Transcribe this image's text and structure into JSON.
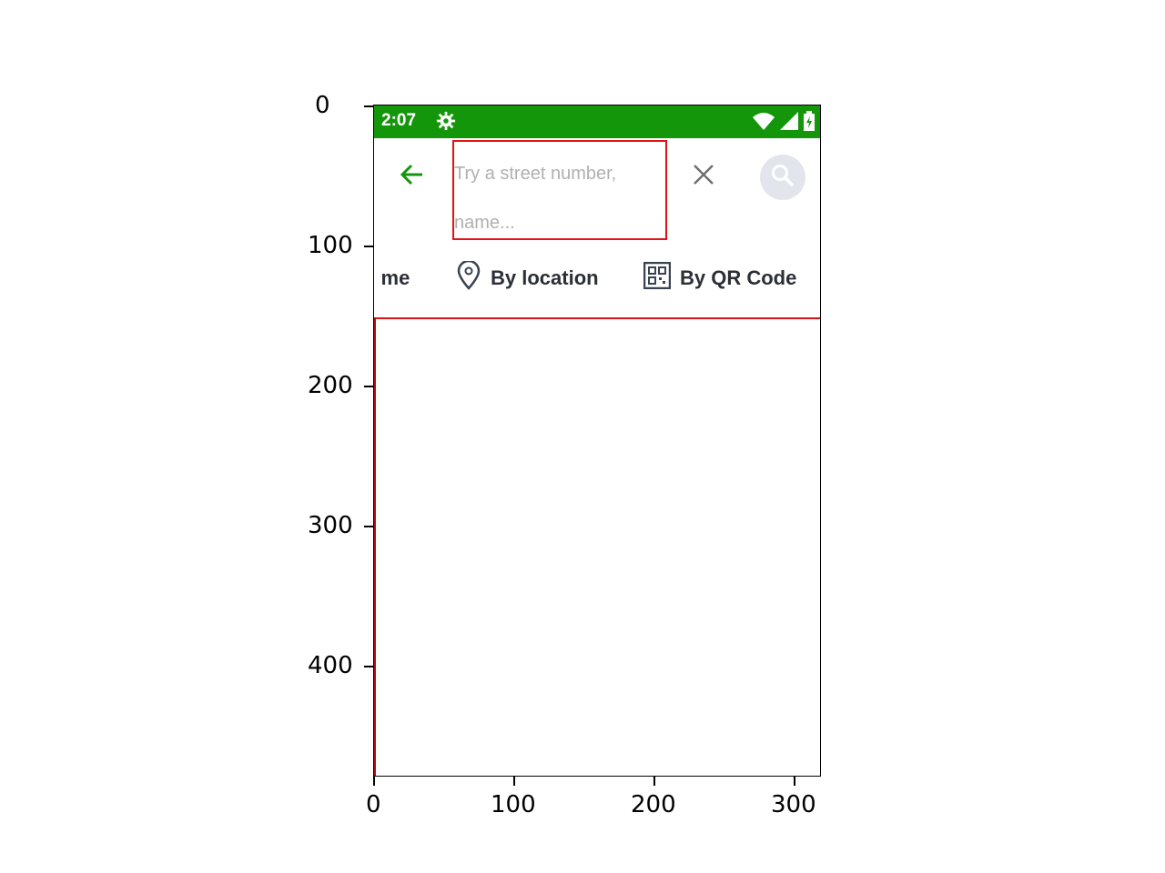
{
  "status_bar": {
    "time": "2:07",
    "bg_color": "#14960a",
    "icons": [
      "settings-gear-icon",
      "wifi-icon",
      "signal-icon",
      "battery-icon"
    ]
  },
  "search": {
    "placeholder": "Try a street number, name...",
    "placeholder_line1": "Try a street number,",
    "placeholder_line2": "name...",
    "icons": [
      "back-arrow-icon",
      "clear-x-icon",
      "search-icon"
    ]
  },
  "options": [
    {
      "label": "d me",
      "icon": "none"
    },
    {
      "label": "By location",
      "icon": "map-pin-icon"
    },
    {
      "label": "By QR Code",
      "icon": "qr-code-icon"
    }
  ],
  "axes": {
    "y_ticks": [
      "0",
      "100",
      "200",
      "300",
      "400"
    ],
    "x_ticks": [
      "0",
      "100",
      "200",
      "300"
    ]
  },
  "colors": {
    "accent_green": "#14960a",
    "highlight_red": "#e01414"
  }
}
